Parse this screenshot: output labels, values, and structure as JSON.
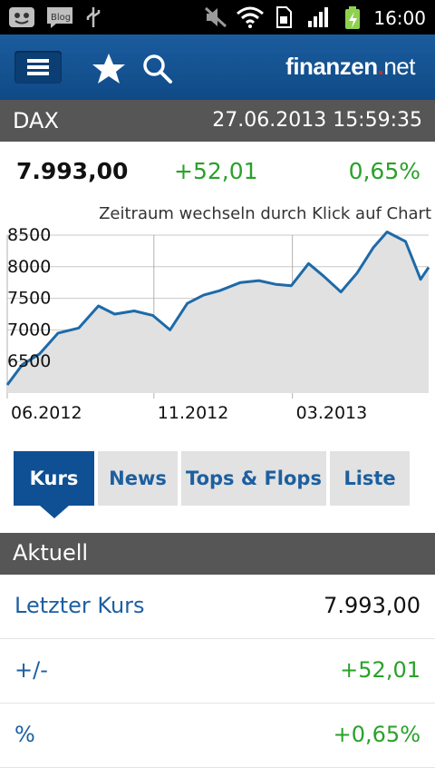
{
  "status_bar": {
    "time": "16:00",
    "icons": [
      "notification-icon",
      "blog-icon",
      "usb-icon",
      "mute-icon",
      "wifi-icon",
      "sim-icon",
      "signal-icon",
      "battery-charging-icon"
    ]
  },
  "app_bar": {
    "logo_main": "finanzen",
    "logo_dot": ".",
    "logo_tld": "net",
    "icons": [
      "menu-icon",
      "star-icon",
      "search-icon"
    ]
  },
  "instrument": {
    "name": "DAX",
    "datetime": "27.06.2013 15:59:35",
    "last": "7.993,00",
    "change": "+52,01",
    "change_pct": "0,65%",
    "positive_color": "#2aa12a"
  },
  "chart_hint": "Zeitraum wechseln durch Klick auf Chart",
  "chart_data": {
    "type": "area",
    "y_ticks": [
      "8500",
      "8000",
      "7500",
      "7000",
      "6500"
    ],
    "x_ticks": [
      "06.2012",
      "11.2012",
      "03.2013"
    ],
    "ylim": [
      6000,
      8500
    ],
    "x": [
      "2012-06-27",
      "2012-07-10",
      "2012-07-25",
      "2012-08-10",
      "2012-08-28",
      "2012-09-14",
      "2012-09-28",
      "2012-10-15",
      "2012-10-31",
      "2012-11-15",
      "2012-11-30",
      "2012-12-14",
      "2012-12-28",
      "2013-01-15",
      "2013-01-31",
      "2013-02-15",
      "2013-02-28",
      "2013-03-15",
      "2013-03-28",
      "2013-04-12",
      "2013-04-26",
      "2013-05-10",
      "2013-05-22",
      "2013-06-07",
      "2013-06-20",
      "2013-06-27"
    ],
    "y": [
      6130,
      6450,
      6620,
      6950,
      7030,
      7380,
      7250,
      7300,
      7230,
      7000,
      7420,
      7550,
      7620,
      7750,
      7780,
      7720,
      7700,
      8050,
      7850,
      7600,
      7900,
      8300,
      8550,
      8400,
      7800,
      7990
    ],
    "line_color": "#1d6aa8",
    "fill_color": "#e1e1e1",
    "grid": true
  },
  "tabs": [
    {
      "label": "Kurs",
      "active": true
    },
    {
      "label": "News",
      "active": false
    },
    {
      "label": "Tops & Flops",
      "active": false
    },
    {
      "label": "Liste",
      "active": false
    }
  ],
  "section_title": "Aktuell",
  "rows": [
    {
      "label": "Letzter Kurs",
      "value": "7.993,00"
    },
    {
      "label": "+/-",
      "value": "+52,01"
    },
    {
      "label": "%",
      "value": "+0,65%"
    }
  ],
  "colors": {
    "brand_blue": "#0f5094",
    "header_gray": "#565656",
    "link_blue": "#1d5fa0"
  }
}
